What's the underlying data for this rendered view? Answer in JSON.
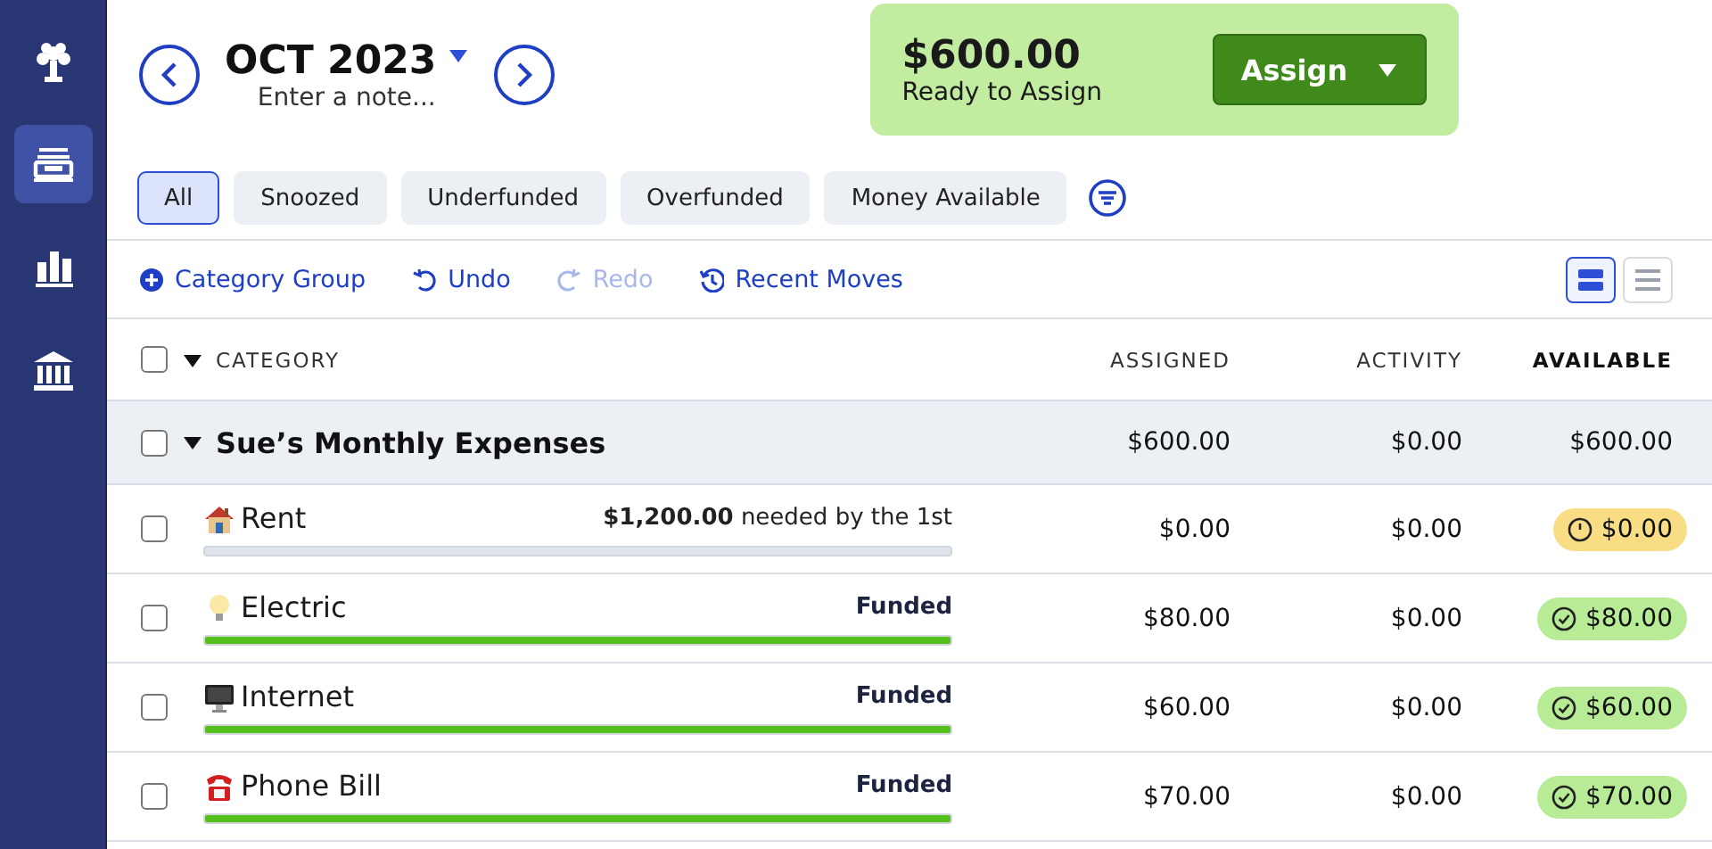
{
  "sidebar": {
    "items": [
      {
        "kind": "logo",
        "selected": false
      },
      {
        "kind": "budget",
        "selected": true
      },
      {
        "kind": "reports",
        "selected": false
      },
      {
        "kind": "accounts",
        "selected": false
      }
    ]
  },
  "month": {
    "title": "OCT 2023",
    "note_placeholder": "Enter a note..."
  },
  "ready": {
    "amount": "$600.00",
    "label": "Ready to Assign",
    "button": "Assign"
  },
  "filters": [
    {
      "label": "All",
      "selected": true
    },
    {
      "label": "Snoozed",
      "selected": false
    },
    {
      "label": "Underfunded",
      "selected": false
    },
    {
      "label": "Overfunded",
      "selected": false
    },
    {
      "label": "Money Available",
      "selected": false
    }
  ],
  "toolbar": [
    {
      "kind": "add",
      "label": "Category Group",
      "disabled": false
    },
    {
      "kind": "undo",
      "label": "Undo",
      "disabled": false
    },
    {
      "kind": "redo",
      "label": "Redo",
      "disabled": true
    },
    {
      "kind": "history",
      "label": "Recent Moves",
      "disabled": false
    }
  ],
  "view_toggle": [
    {
      "kind": "expanded",
      "selected": true
    },
    {
      "kind": "compact",
      "selected": false
    }
  ],
  "table": {
    "columns": [
      "CATEGORY",
      "ASSIGNED",
      "ACTIVITY",
      "AVAILABLE"
    ],
    "select_all": {
      "checked": false
    },
    "group": {
      "name": "Sue’s Monthly Expenses",
      "checked": false,
      "expanded": true,
      "assigned": "$600.00",
      "activity": "$0.00",
      "available": "$600.00"
    },
    "rows": [
      {
        "kind": "underfunded",
        "name": "Rent",
        "checked": false,
        "target": "**$1,200.00** needed by the 1st",
        "level": 0,
        "assigned": "$0.00",
        "activity": "$0.00",
        "available": "$0.00",
        "color": "#f8dd85"
      },
      {
        "kind": "funded",
        "name": "Electric",
        "checked": false,
        "target": "Funded",
        "level": 1,
        "assigned": "$80.00",
        "activity": "$0.00",
        "available": "$80.00",
        "color": "#b8eb95"
      },
      {
        "kind": "funded",
        "name": "Internet",
        "checked": false,
        "target": "Funded",
        "level": 1,
        "assigned": "$60.00",
        "activity": "$0.00",
        "available": "$60.00",
        "color": "#b8eb95"
      },
      {
        "kind": "funded",
        "name": "Phone Bill",
        "checked": false,
        "target": "Funded",
        "level": 1,
        "assigned": "$70.00",
        "activity": "$0.00",
        "available": "$70.00",
        "color": "#b8eb95"
      }
    ]
  }
}
